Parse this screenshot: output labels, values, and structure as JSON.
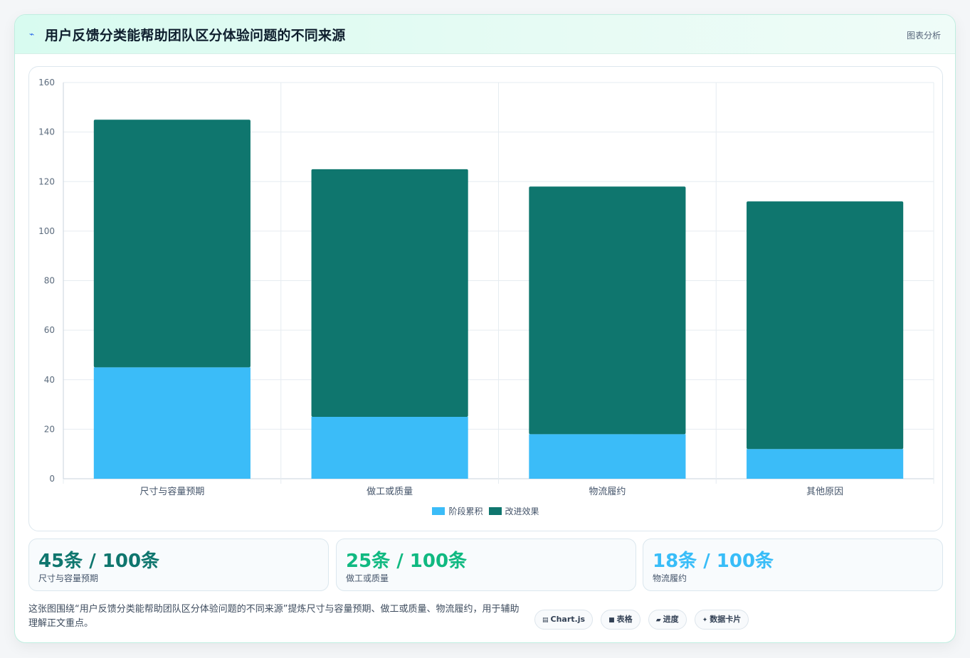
{
  "header": {
    "title": "用户反馈分类能帮助团队区分体验问题的不同来源",
    "tag": "图表分析",
    "icon": "sparkline-icon"
  },
  "chart_data": {
    "type": "bar",
    "stacked": true,
    "categories": [
      "尺寸与容量预期",
      "做工或质量",
      "物流履约",
      "其他原因"
    ],
    "series": [
      {
        "name": "阶段累积",
        "values": [
          45,
          25,
          18,
          12
        ],
        "color": "#3bbcf8"
      },
      {
        "name": "改进效果",
        "values": [
          100,
          100,
          100,
          100
        ],
        "color": "#0f766e"
      }
    ],
    "ylim": [
      0,
      160
    ],
    "yticks": [
      0,
      20,
      40,
      60,
      80,
      100,
      120,
      140,
      160
    ],
    "grid": true,
    "legend": "bottom-center"
  },
  "stats": [
    {
      "value": "45条 / 100条",
      "label": "尺寸与容量预期",
      "color": "#0f766e"
    },
    {
      "value": "25条 / 100条",
      "label": "做工或质量",
      "color": "#10b981"
    },
    {
      "value": "18条 / 100条",
      "label": "物流履约",
      "color": "#38bdf8"
    }
  ],
  "footer": {
    "description": "这张图围绕“用户反馈分类能帮助团队区分体验问题的不同来源”提炼尺寸与容量预期、做工或质量、物流履约，用于辅助理解正文重点。"
  },
  "chips": [
    {
      "icon": "▤",
      "label": "Chart.js",
      "icon_name": "chart-icon"
    },
    {
      "icon": "■",
      "label": "表格",
      "icon_name": "table-icon"
    },
    {
      "icon": "▰",
      "label": "进度",
      "icon_name": "progress-icon"
    },
    {
      "icon": "✦",
      "label": "数据卡片",
      "icon_name": "sparkle-icon"
    }
  ]
}
